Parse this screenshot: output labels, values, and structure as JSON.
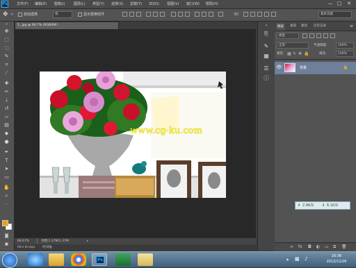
{
  "menubar": {
    "logo": "Ps",
    "items": [
      "文件(F)",
      "编辑(E)",
      "图像(I)",
      "图层(L)",
      "类型(Y)",
      "选择(S)",
      "滤镜(T)",
      "3D(D)",
      "视图(V)",
      "窗口(W)",
      "帮助(H)"
    ],
    "window_controls": [
      "—",
      "□",
      "✕"
    ]
  },
  "options": {
    "auto_select": "自动选择",
    "group_value": "组",
    "transform": "显示变换控件",
    "workspace": "基本功能"
  },
  "document": {
    "tab_title": "1_.jpg @ 66.7% (RGB/8#)",
    "zoom": "66.67%",
    "doc_info": "文档:1.37M/1.37M",
    "bottom_tabs": [
      "Mini Bridge",
      "时间轴"
    ],
    "watermark": "www.cg-ku.com"
  },
  "panel": {
    "tabs": [
      "图层",
      "通道",
      "路径",
      "历史记录"
    ],
    "kind_label": "类型",
    "blend_mode": "正常",
    "opacity_label": "不透明度:",
    "opacity_value": "100%",
    "lock_label": "锁定:",
    "fill_label": "填充:",
    "fill_value": "100%",
    "layer_name": "背景"
  },
  "speed_widget": {
    "up": "2.9K/S",
    "down": "6.1K/S"
  },
  "taskbar": {
    "clock_time": "16:36",
    "clock_date": "2012/12/26"
  },
  "colors": {
    "brand": "#31a8ff",
    "layer_selected": "#6d7f99",
    "watermark": "#ffff00"
  }
}
